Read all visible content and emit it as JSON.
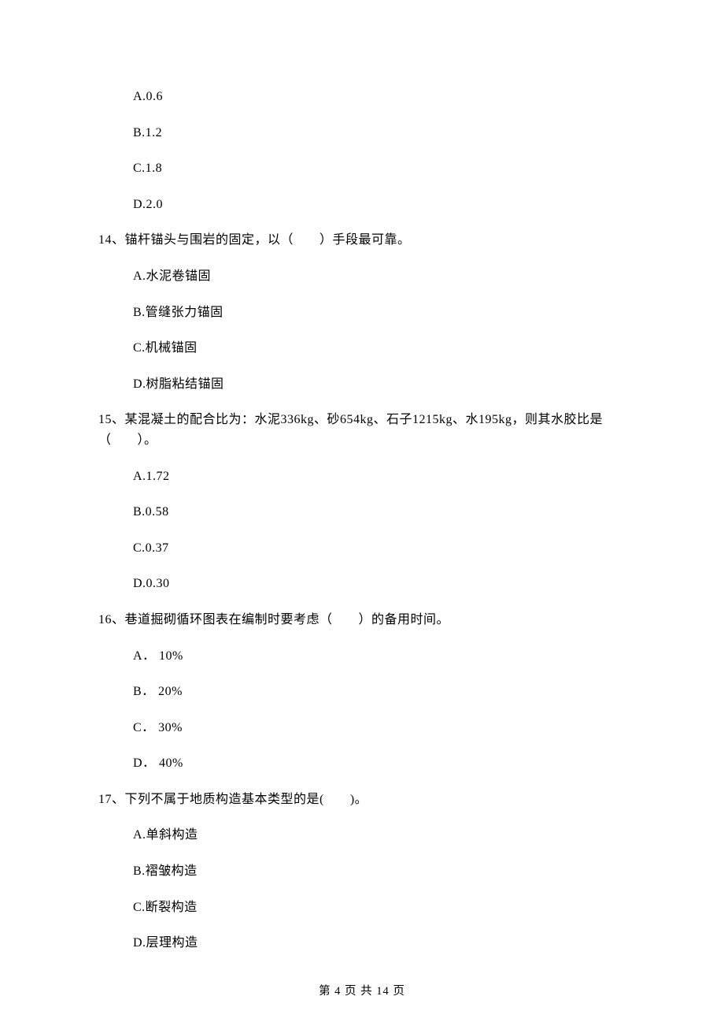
{
  "block1_options": {
    "A": "A.0.6",
    "B": "B.1.2",
    "C": "C.1.8",
    "D": "D.2.0"
  },
  "q14": {
    "text": "14、锚杆锚头与围岩的固定，以（　　）手段最可靠。",
    "options": {
      "A": "A.水泥卷锚固",
      "B": "B.管缝张力锚固",
      "C": "C.机械锚固",
      "D": "D.树脂粘结锚固"
    }
  },
  "q15": {
    "text": "15、某混凝土的配合比为：水泥336kg、砂654kg、石子1215kg、水195kg，则其水胶比是（　　）。",
    "options": {
      "A": "A.1.72",
      "B": "B.0.58",
      "C": "C.0.37",
      "D": "D.0.30"
    }
  },
  "q16": {
    "text": "16、巷道掘砌循环图表在编制时要考虑（　　）的备用时间。",
    "options": {
      "A": "A． 10%",
      "B": "B． 20%",
      "C": "C． 30%",
      "D": "D． 40%"
    }
  },
  "q17": {
    "text": "17、下列不属于地质构造基本类型的是(　　)。",
    "options": {
      "A": "A.单斜构造",
      "B": "B.褶皱构造",
      "C": "C.断裂构造",
      "D": "D.层理构造"
    }
  },
  "footer": "第 4 页 共 14 页"
}
